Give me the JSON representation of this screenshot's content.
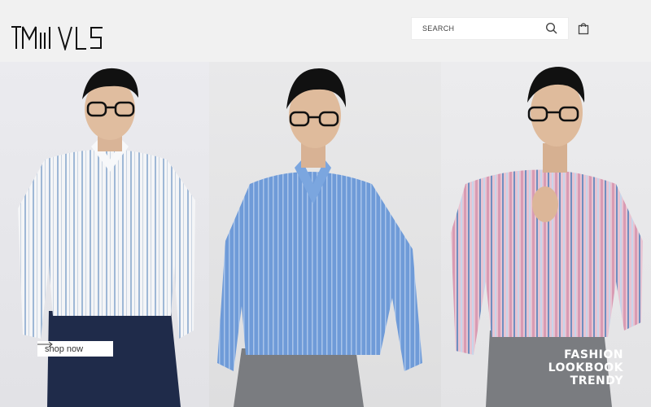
{
  "brand": {
    "logo_text": "MIVLS"
  },
  "search": {
    "placeholder": "SEARCH"
  },
  "icons": {
    "search": "search-icon",
    "cart": "shopping-bag-icon",
    "arrow": "arrow-right-icon"
  },
  "hero": {
    "cta_label": "shop now",
    "lookbook_lines": [
      "FASHION",
      "LOOKBOOK",
      "TRENDY"
    ]
  },
  "colors": {
    "header_bg": "#f1f1f1",
    "shirt_white_stripe": "#9fb8d6",
    "shirt_blue": "#6f9bd8",
    "shirt_pink": "#d99bb3",
    "pants_navy": "#1f2b4a",
    "pants_grey": "#7a7c80"
  }
}
